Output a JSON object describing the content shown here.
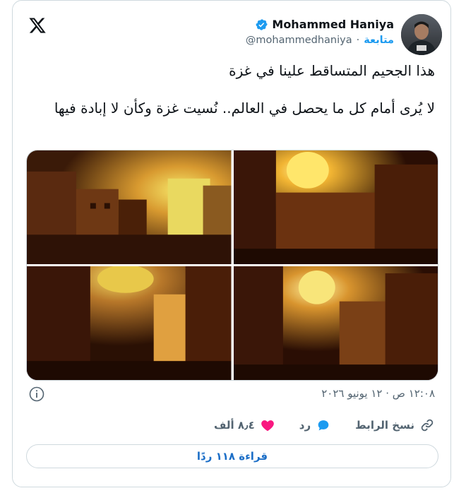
{
  "author": {
    "name": "Mohammed Haniya",
    "handle": "@mohammedhaniya",
    "follow_label": "متابعة",
    "separator": "·"
  },
  "tweet": {
    "text_line1": "هذا الجحيم المتساقط علينا في غزة",
    "text_line2": "لا يُرى أمام كل ما يحصل في العالم.. نُسيت غزة وكأن لا إبادة فيها",
    "timestamp": "١٢:٠٨ ص · ١٢ يونيو ٢٠٢٦"
  },
  "actions": {
    "likes_count": "٨٫٤ ألف",
    "reply_label": "رد",
    "copy_link_label": "نسخ الرابط"
  },
  "read_replies_label": "قراءة ١١٨ ردًا",
  "icons": {
    "platform": "x-logo-icon",
    "verified": "verified-badge-icon",
    "info": "info-icon",
    "like": "heart-icon",
    "reply": "speech-bubble-icon",
    "copy_link": "link-icon"
  },
  "colors": {
    "accent": "#1d9bf0",
    "like": "#f91880",
    "text": "#0f1419",
    "muted": "#536471",
    "border": "#cfd9de"
  }
}
